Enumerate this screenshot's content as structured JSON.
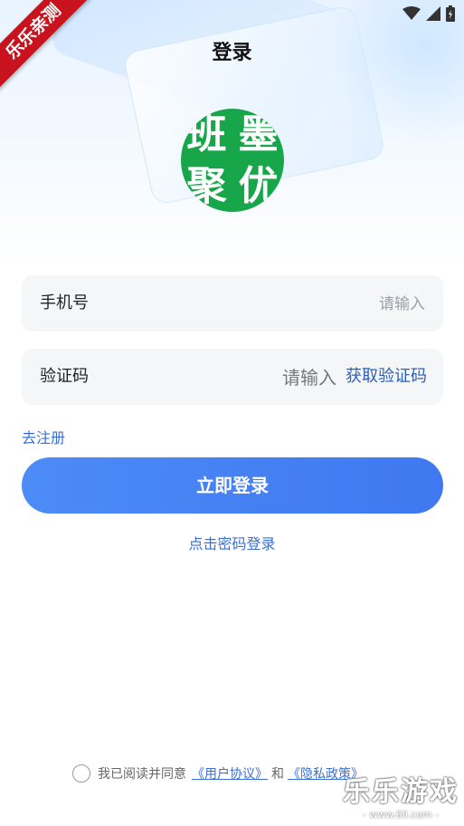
{
  "header": {
    "title": "登录"
  },
  "ribbon": {
    "text": "乐乐亲测"
  },
  "logo": {
    "chars": [
      "班",
      "墨",
      "聚",
      "优"
    ]
  },
  "phone_field": {
    "label": "手机号",
    "placeholder": "请输入",
    "value": ""
  },
  "code_field": {
    "label": "验证码",
    "placeholder": "请输入",
    "value": "",
    "get_code_label": "获取验证码"
  },
  "register_link": "去注册",
  "login_button": "立即登录",
  "password_login_link": "点击密码登录",
  "agreement": {
    "prefix": "我已阅读并同意",
    "user_agreement": "《用户协议》",
    "and": "和",
    "privacy_policy": "《隐私政策》",
    "checked": false
  },
  "watermark": {
    "title": "乐乐游戏",
    "url": "- www.6ll.com -"
  },
  "colors": {
    "accent": "#3f78f0",
    "link": "#3b6fd6",
    "logo_bg": "#17a64a",
    "ribbon": "#c8121e"
  },
  "icons": [
    "wifi-icon",
    "cell-signal-icon",
    "battery-icon"
  ]
}
